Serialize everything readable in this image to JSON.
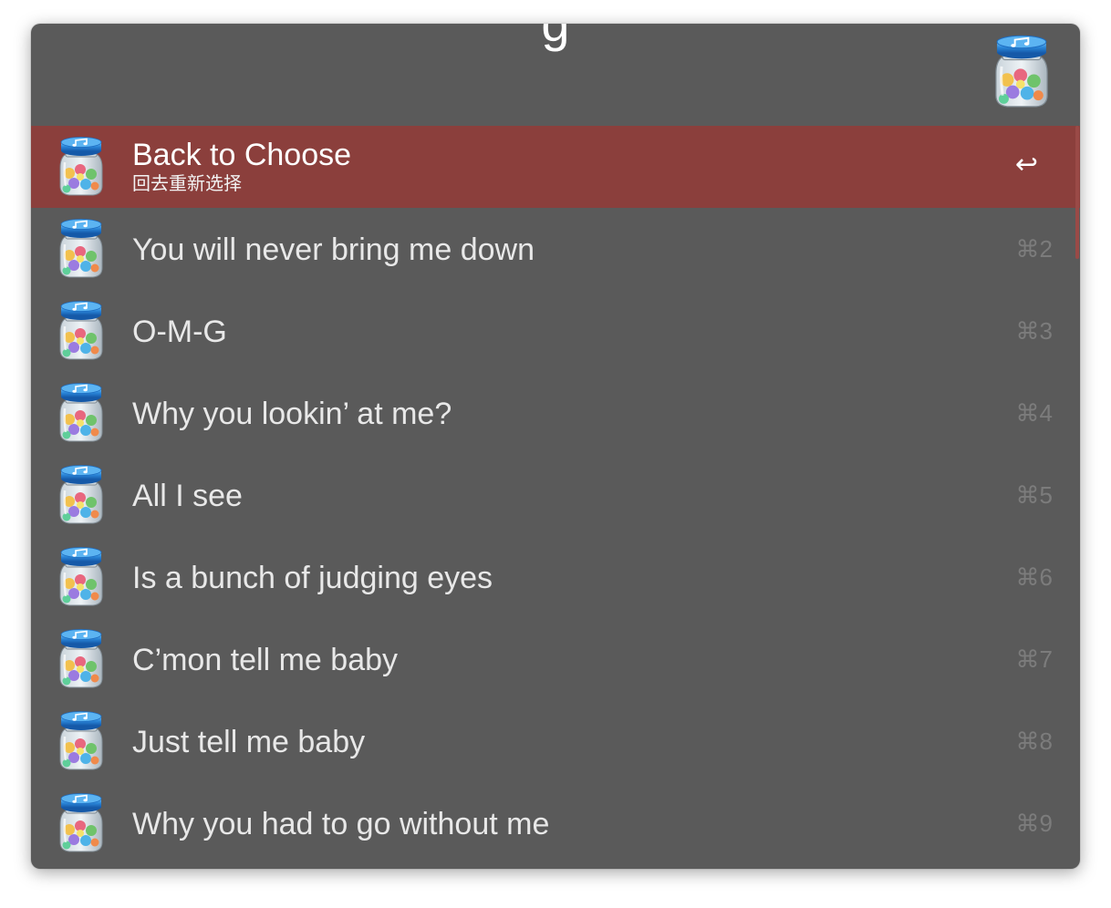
{
  "search": {
    "query": "g",
    "app_icon": "jar-music-icon"
  },
  "results": [
    {
      "title": "Back to Choose",
      "subtitle": "回去重新选择",
      "shortcut": "↩",
      "selected": true,
      "icon": "jar-music-icon"
    },
    {
      "title": "You will never bring me down",
      "subtitle": "",
      "shortcut": "⌘2",
      "selected": false,
      "icon": "jar-music-icon"
    },
    {
      "title": "O-M-G",
      "subtitle": "",
      "shortcut": "⌘3",
      "selected": false,
      "icon": "jar-music-icon"
    },
    {
      "title": "Why you lookin’ at me?",
      "subtitle": "",
      "shortcut": "⌘4",
      "selected": false,
      "icon": "jar-music-icon"
    },
    {
      "title": "All I see",
      "subtitle": "",
      "shortcut": "⌘5",
      "selected": false,
      "icon": "jar-music-icon"
    },
    {
      "title": "Is a bunch of judging eyes",
      "subtitle": "",
      "shortcut": "⌘6",
      "selected": false,
      "icon": "jar-music-icon"
    },
    {
      "title": "C’mon tell me baby",
      "subtitle": "",
      "shortcut": "⌘7",
      "selected": false,
      "icon": "jar-music-icon"
    },
    {
      "title": "Just tell me baby",
      "subtitle": "",
      "shortcut": "⌘8",
      "selected": false,
      "icon": "jar-music-icon"
    },
    {
      "title": "Why you had to go without me",
      "subtitle": "",
      "shortcut": "⌘9",
      "selected": false,
      "icon": "jar-music-icon"
    }
  ],
  "colors": {
    "window_bg": "#5a5a5a",
    "selection_bg": "#8b3f3c",
    "text": "#e8e8e8",
    "shortcut_text": "#7c7c7c"
  }
}
